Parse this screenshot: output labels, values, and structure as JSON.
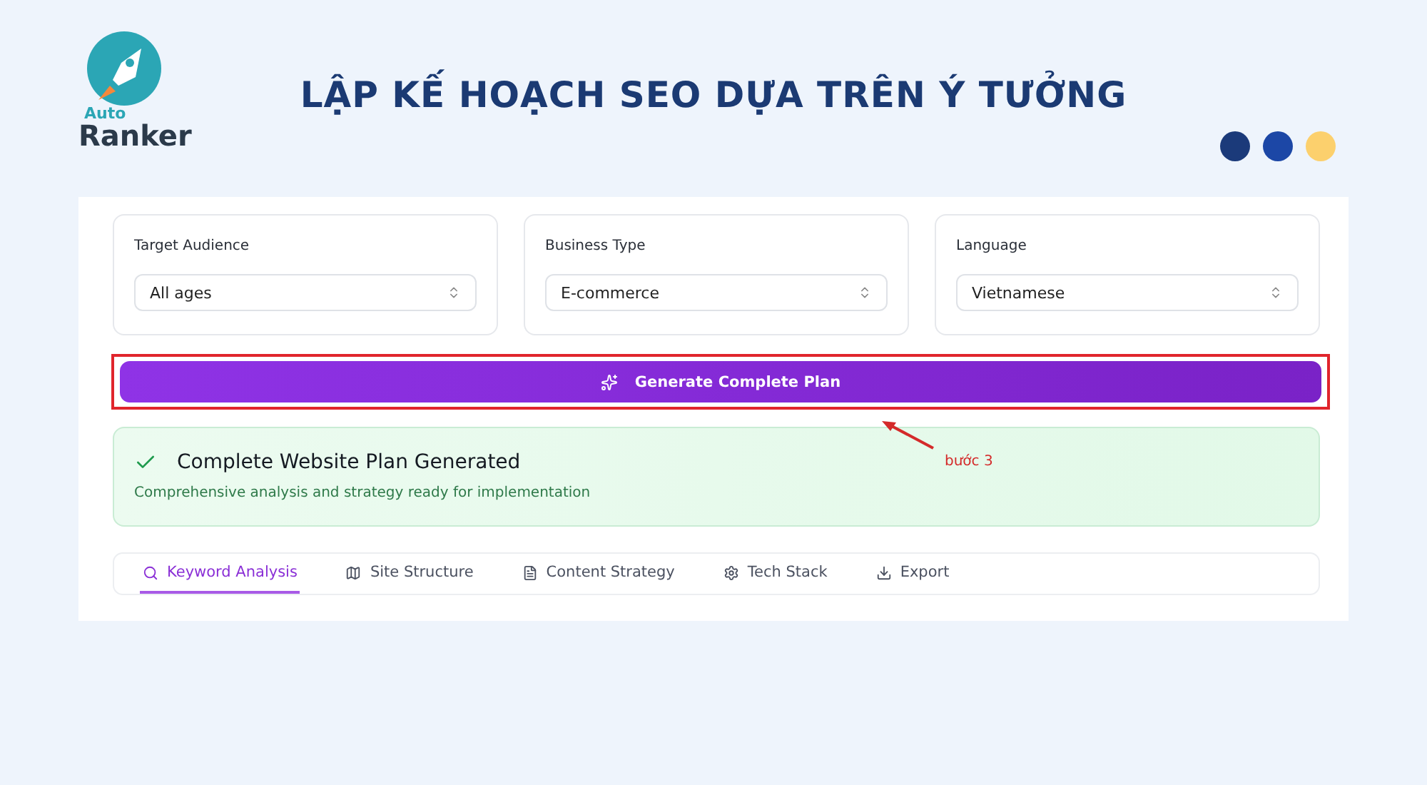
{
  "logo": {
    "small": "Auto",
    "name": "Ranker"
  },
  "title": "LẬP KẾ HOẠCH SEO DỰA TRÊN Ý TƯỞNG",
  "dots": [
    {
      "color": "#1b3a7a"
    },
    {
      "color": "#1c47a6"
    },
    {
      "color": "#fcd06d"
    }
  ],
  "selects": [
    {
      "label": "Target Audience",
      "value": "All ages"
    },
    {
      "label": "Business Type",
      "value": "E-commerce"
    },
    {
      "label": "Language",
      "value": "Vietnamese"
    }
  ],
  "generate_button": {
    "label": "Generate Complete Plan",
    "highlighted": true
  },
  "annotation": {
    "text": "bước 3"
  },
  "success": {
    "title": "Complete Website Plan Generated",
    "text": "Comprehensive analysis and strategy ready for implementation"
  },
  "tabs": [
    {
      "label": "Keyword Analysis",
      "kind": "search",
      "selected": true
    },
    {
      "label": "Site Structure",
      "kind": "map",
      "selected": false
    },
    {
      "label": "Content Strategy",
      "kind": "file",
      "selected": false
    },
    {
      "label": "Tech Stack",
      "kind": "gear",
      "selected": false
    },
    {
      "label": "Export",
      "kind": "download",
      "selected": false
    }
  ]
}
